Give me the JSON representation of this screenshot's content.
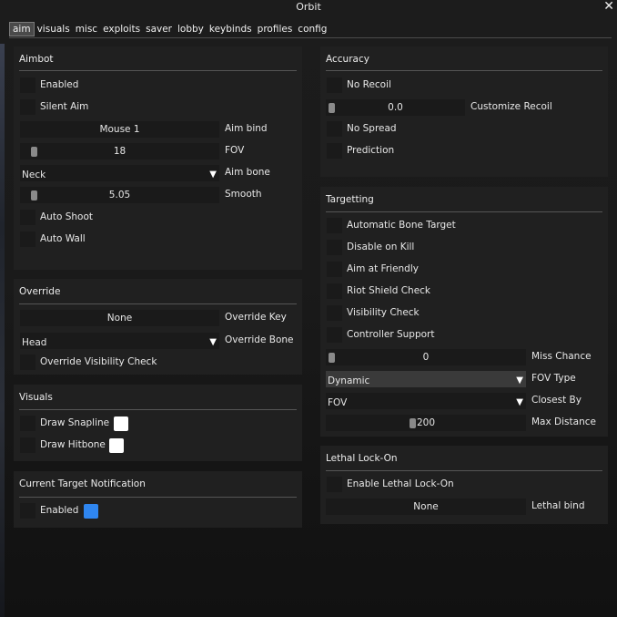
{
  "window": {
    "title": "Orbit",
    "close_glyph": "✕"
  },
  "tabs": [
    "aim",
    "visuals",
    "misc",
    "exploits",
    "saver",
    "lobby",
    "keybinds",
    "profiles",
    "config"
  ],
  "aimbot": {
    "title": "Aimbot",
    "enabled": "Enabled",
    "silent_aim": "Silent Aim",
    "aim_bind_value": "Mouse 1",
    "aim_bind_label": "Aim bind",
    "fov_value": "18",
    "fov_label": "FOV",
    "aim_bone_value": "Neck",
    "aim_bone_label": "Aim bone",
    "smooth_value": "5.05",
    "smooth_label": "Smooth",
    "auto_shoot": "Auto Shoot",
    "auto_wall": "Auto Wall"
  },
  "override": {
    "title": "Override",
    "key_value": "None",
    "key_label": "Override Key",
    "bone_value": "Head",
    "bone_label": "Override Bone",
    "visibility": "Override Visibility Check"
  },
  "visuals": {
    "title": "Visuals",
    "draw_snapline": "Draw Snapline",
    "draw_hitbone": "Draw Hitbone",
    "snapline_color": "#ffffff",
    "hitbone_color": "#ffffff"
  },
  "notification": {
    "title": "Current Target Notification",
    "enabled": "Enabled",
    "color": "#2f86f0"
  },
  "accuracy": {
    "title": "Accuracy",
    "no_recoil": "No Recoil",
    "recoil_value": "0.0",
    "recoil_label": "Customize Recoil",
    "no_spread": "No Spread",
    "prediction": "Prediction"
  },
  "targetting": {
    "title": "Targetting",
    "items": [
      "Automatic Bone Target",
      "Disable on Kill",
      "Aim at Friendly",
      "Riot Shield Check",
      "Visibility Check",
      "Controller Support"
    ],
    "miss_value": "0",
    "miss_label": "Miss Chance",
    "fov_type_value": "Dynamic",
    "fov_type_label": "FOV Type",
    "closest_value": "FOV",
    "closest_label": "Closest By",
    "distance_value": "200",
    "distance_label": "Max Distance"
  },
  "lethal": {
    "title": "Lethal Lock-On",
    "enable": "Enable Lethal Lock-On",
    "bind_value": "None",
    "bind_label": "Lethal bind"
  },
  "arrow_glyph": "▼"
}
